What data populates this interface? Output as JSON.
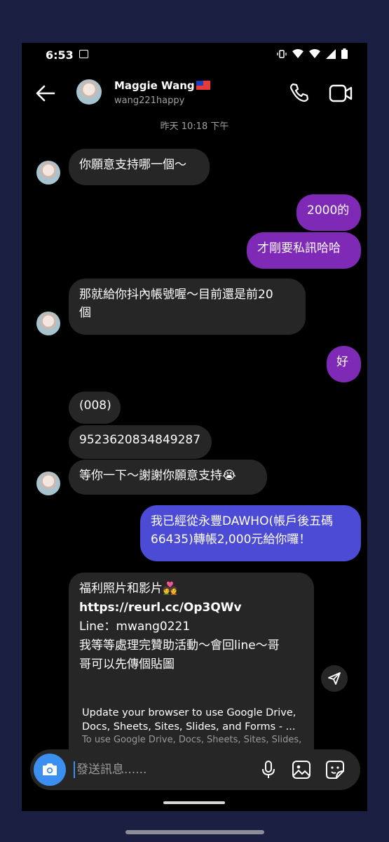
{
  "status_bar": {
    "time": "6:53"
  },
  "header": {
    "name": "Maggie Wang",
    "flag_icon": "taiwan-flag-icon",
    "username": "wang221happy"
  },
  "timestamp": "昨天 10:18 下午",
  "messages": [
    {
      "text": "你願意支持哪一個～"
    },
    {
      "text": "2000的"
    },
    {
      "text": "才剛要私訊哈哈"
    },
    {
      "text": "那就給你抖內帳號喔～目前還是前20\n個"
    },
    {
      "text": "好"
    },
    {
      "text": "(008)"
    },
    {
      "text": "9523620834849287"
    },
    {
      "text": "等你一下～謝謝你願意支持😭"
    },
    {
      "text": "我已經從永豐DAWHO(帳戶後五碼\n66435)轉帳2,000元給你囉！"
    }
  ],
  "shared_message": {
    "line1": "福利照片和影片💑",
    "link": "https://reurl.cc/Op3QWv",
    "line3": "Line：mwang0221",
    "line4": "我等等處理完贊助活動～會回line～哥\n哥可以先傳個貼圖",
    "preview_title": "Update your browser to use Google Drive, Docs, Sheets, Sites, Slides, and Forms - ...",
    "preview_desc": "To use Google Drive, Docs, Sheets, Sites, Slides,"
  },
  "composer": {
    "placeholder": "發送訊息......"
  },
  "colors": {
    "outgoing_purple": "#7f2ab7",
    "outgoing_blue": "#4c4bd6",
    "incoming": "#262626",
    "accent": "#3b8ff0"
  }
}
